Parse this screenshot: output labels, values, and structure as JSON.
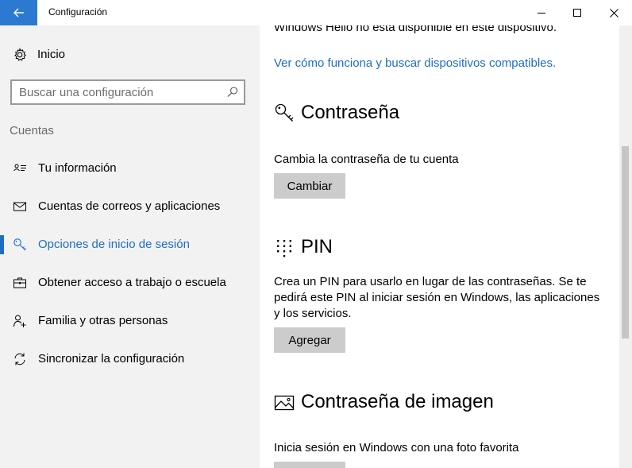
{
  "window": {
    "title": "Configuración"
  },
  "sidebar": {
    "home_label": "Inicio",
    "search_placeholder": "Buscar una configuración",
    "section_label": "Cuentas",
    "items": [
      {
        "label": "Tu información",
        "icon": "person-card-icon",
        "active": false
      },
      {
        "label": "Cuentas de correos y aplicaciones",
        "icon": "mail-icon",
        "active": false
      },
      {
        "label": "Opciones de inicio de sesión",
        "icon": "key-icon",
        "active": true
      },
      {
        "label": "Obtener acceso a trabajo o escuela",
        "icon": "briefcase-icon",
        "active": false
      },
      {
        "label": "Familia y otras personas",
        "icon": "person-add-icon",
        "active": false
      },
      {
        "label": "Sincronizar la configuración",
        "icon": "sync-icon",
        "active": false
      }
    ]
  },
  "main": {
    "windows_hello_text": "Windows Hello no está disponible en este dispositivo.",
    "windows_hello_link": "Ver cómo funciona y buscar dispositivos compatibles.",
    "password": {
      "title": "Contraseña",
      "description": "Cambia la contraseña de tu cuenta",
      "button": "Cambiar"
    },
    "pin": {
      "title": "PIN",
      "description": "Crea un PIN para usarlo en lugar de las contraseñas. Se te pedirá este PIN al iniciar sesión en Windows, las aplicaciones y los servicios.",
      "button": "Agregar"
    },
    "picture_password": {
      "title": "Contraseña de imagen",
      "description": "Inicia sesión en Windows con una foto favorita"
    }
  },
  "colors": {
    "accent": "#1e6ec8",
    "back_button": "#2b79d1",
    "sidebar_bg": "#f2f2f2",
    "button_bg": "#cccccc"
  }
}
